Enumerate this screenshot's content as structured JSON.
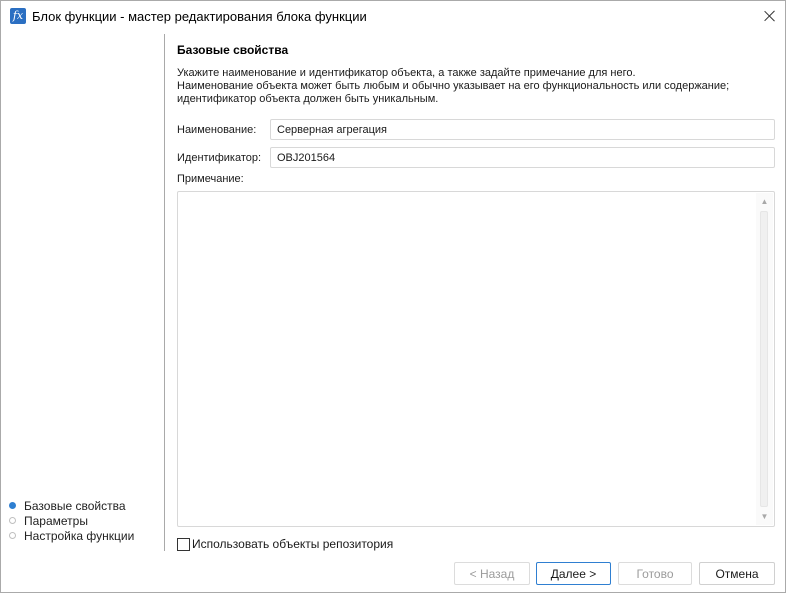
{
  "window": {
    "title": "Блок функции - мастер редактирования блока функции",
    "app_icon_glyph": "fx",
    "icons": [
      "function-icon",
      "close-icon"
    ]
  },
  "nav": {
    "items": [
      {
        "label": "Базовые свойства",
        "active": true
      },
      {
        "label": "Параметры",
        "active": false
      },
      {
        "label": "Настройка функции",
        "active": false
      }
    ]
  },
  "main": {
    "section_title": "Базовые свойства",
    "description": [
      "Укажите наименование и идентификатор объекта, а также задайте примечание для него.",
      "Наименование объекта может быть любым и обычно указывает на его функциональность или содержание;",
      "идентификатор объекта должен быть уникальным."
    ],
    "name_label": "Наименование:",
    "name_value": "Серверная агрегация",
    "id_label": "Идентификатор:",
    "id_value": "OBJ201564",
    "note_label": "Примечание:",
    "note_value": "",
    "repo_checkbox_label": "Использовать объекты репозитория",
    "repo_checkbox_checked": false
  },
  "buttons": {
    "back": "< Назад",
    "next": "Далее >",
    "finish": "Готово",
    "cancel": "Отмена"
  },
  "colors": {
    "accent": "#2f7fd1",
    "app_icon": "#2b6fc2",
    "disabled_text": "#9b9b9b"
  }
}
